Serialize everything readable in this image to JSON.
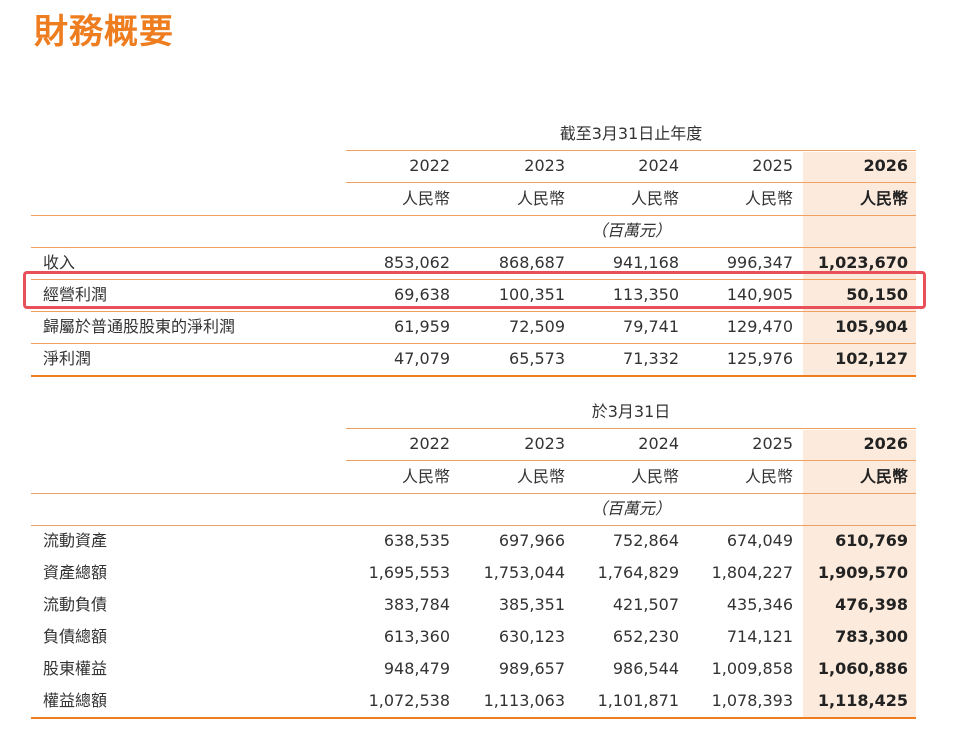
{
  "title": "財務概要",
  "currency": "人民幣",
  "unit": "（百萬元）",
  "years": [
    "2022",
    "2023",
    "2024",
    "2025",
    "2026"
  ],
  "income": {
    "period": "截至3月31日止年度",
    "rows": [
      {
        "label": "收入",
        "values": [
          "853,062",
          "868,687",
          "941,168",
          "996,347",
          "1,023,670"
        ]
      },
      {
        "label": "經營利潤",
        "values": [
          "69,638",
          "100,351",
          "113,350",
          "140,905",
          "50,150"
        ]
      },
      {
        "label": "歸屬於普通股股東的淨利潤",
        "values": [
          "61,959",
          "72,509",
          "79,741",
          "129,470",
          "105,904"
        ]
      },
      {
        "label": "淨利潤",
        "values": [
          "47,079",
          "65,573",
          "71,332",
          "125,976",
          "102,127"
        ]
      }
    ]
  },
  "balance": {
    "period": "於3月31日",
    "rows": [
      {
        "label": "流動資產",
        "values": [
          "638,535",
          "697,966",
          "752,864",
          "674,049",
          "610,769"
        ]
      },
      {
        "label": "資產總額",
        "values": [
          "1,695,553",
          "1,753,044",
          "1,764,829",
          "1,804,227",
          "1,909,570"
        ]
      },
      {
        "label": "流動負債",
        "values": [
          "383,784",
          "385,351",
          "421,507",
          "435,346",
          "476,398"
        ]
      },
      {
        "label": "負債總額",
        "values": [
          "613,360",
          "630,123",
          "652,230",
          "714,121",
          "783,300"
        ]
      },
      {
        "label": "股東權益",
        "values": [
          "948,479",
          "989,657",
          "986,544",
          "1,009,858",
          "1,060,886"
        ]
      },
      {
        "label": "權益總額",
        "values": [
          "1,072,538",
          "1,113,063",
          "1,101,871",
          "1,078,393",
          "1,118,425"
        ]
      }
    ]
  },
  "colors": {
    "accent": "#ee7d1f",
    "highlight_column": "#fcebdd",
    "highlight_box": "#e8505a"
  }
}
